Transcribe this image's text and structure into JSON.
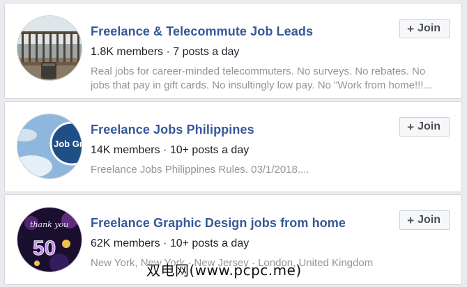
{
  "groups": [
    {
      "title": "Freelance & Telecommute Job Leads",
      "meta": "1.8K members · 7 posts a day",
      "desc_line1": "Real jobs for career-minded telecommuters. No surveys. No rebates. No",
      "desc_line2": "jobs that pay in gift cards. No insultingly low pay. No \"Work from home!!!...",
      "join_label": "Join",
      "avatar_icon": "balcony-coffee-photo"
    },
    {
      "title": "Freelance Jobs Philippines",
      "meta": "14K members · 10+ posts a day",
      "desc_line1": "Freelance Jobs Philippines Rules. 03/1/2018....",
      "join_label": "Join",
      "avatar_icon": "job-group-sky-photo",
      "avatar_text": "Job Gro"
    },
    {
      "title": "Freelance Graphic Design jobs from home",
      "meta": "62K members · 10+ posts a day",
      "desc_line1": "New York, New York · New Jersey · London, United Kingdom",
      "join_label": "Join",
      "avatar_icon": "thank-you-50k-photo",
      "avatar_text_top": "thank you",
      "avatar_text_num": "50"
    }
  ],
  "watermark": "双电网(www.pcpc.me)",
  "colors": {
    "title": "#365899",
    "meta": "#1d2129",
    "desc": "#90949c",
    "background": "#e9ebee"
  }
}
